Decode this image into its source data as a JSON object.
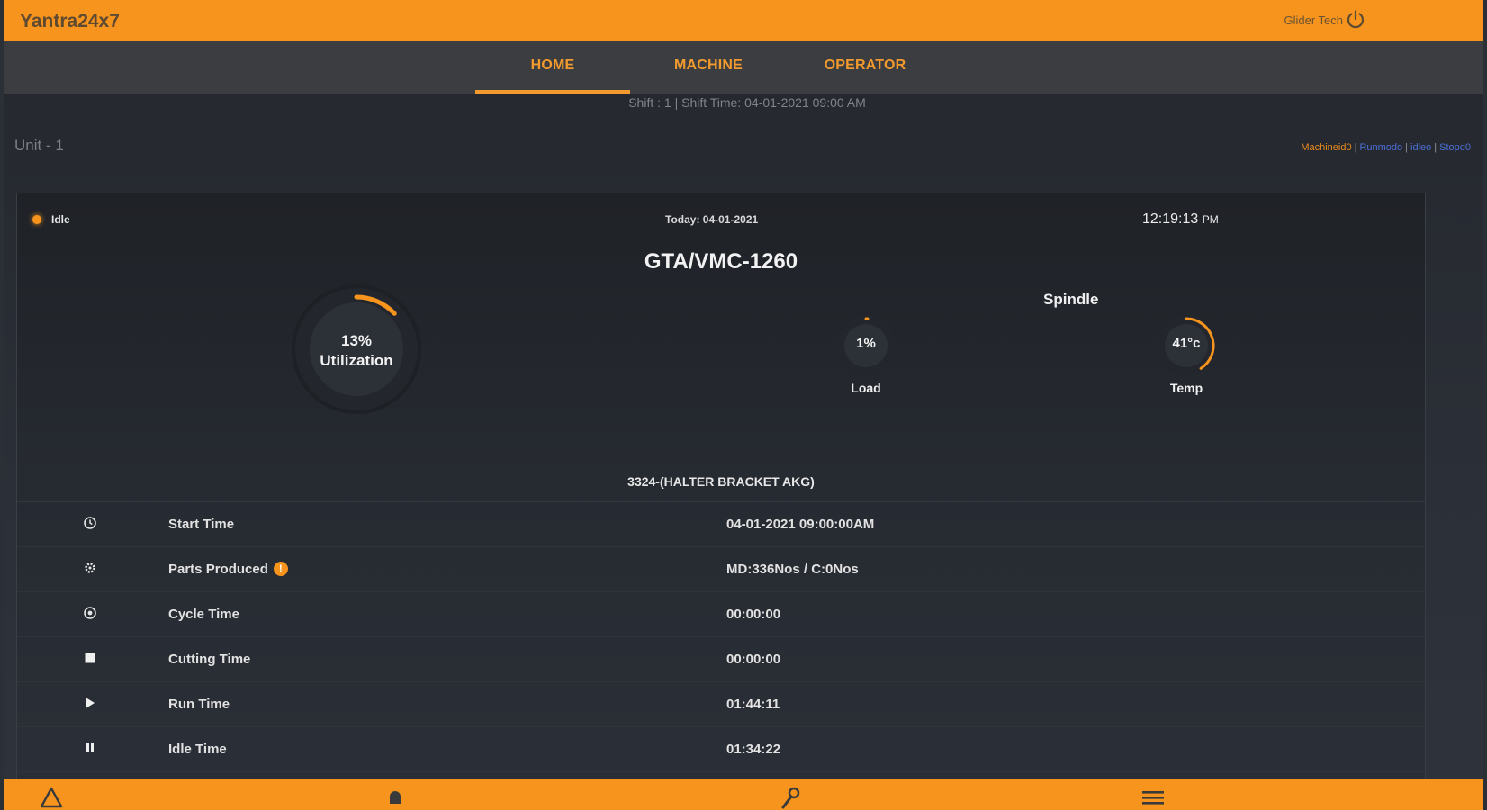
{
  "app": {
    "title": "Yantra24x7",
    "user": "Glider Tech"
  },
  "nav": {
    "tabs": [
      {
        "label": "HOME"
      },
      {
        "label": "MACHINE"
      },
      {
        "label": "OPERATOR"
      }
    ]
  },
  "shift_info": "Shift : 1 | Shift Time: 04-01-2021 09:00 AM",
  "unit": "Unit - 1",
  "links": [
    "Machineid0",
    "Runmodo",
    "idleo",
    "Stopd0"
  ],
  "card": {
    "status": "Idle",
    "today": "Today: 04-01-2021",
    "clock_time": "12:19:13",
    "clock_ampm": "PM",
    "machine_name": "GTA/VMC-1260",
    "spindle_title": "Spindle",
    "utilization": {
      "value_text": "13%",
      "label": "Utilization",
      "fraction": 0.13
    },
    "load": {
      "value_text": "1%",
      "label": "Load",
      "fraction": 0.01
    },
    "temp": {
      "value_text": "41°c",
      "label": "Temp",
      "fraction": 0.41
    },
    "job": "3324-(HALTER BRACKET AKG)",
    "rows": [
      {
        "icon": "clock-icon",
        "label": "Start Time",
        "value": "04-01-2021 09:00:00AM"
      },
      {
        "icon": "gear-icon",
        "label": "Parts Produced",
        "value": "MD:336Nos / C:0Nos"
      },
      {
        "icon": "timer-icon",
        "label": "Cycle Time",
        "value": "00:00:00"
      },
      {
        "icon": "square-icon",
        "label": "Cutting Time",
        "value": "00:00:00"
      },
      {
        "icon": "play-icon",
        "label": "Run Time",
        "value": "01:44:11"
      },
      {
        "icon": "pause-icon",
        "label": "Idle Time",
        "value": "01:34:22"
      }
    ]
  },
  "colors": {
    "accent": "#f7941d",
    "link": "#4a6fd6"
  },
  "bottom_icons": [
    "warning-icon",
    "bell-icon",
    "wrench-icon",
    "menu-icon"
  ]
}
